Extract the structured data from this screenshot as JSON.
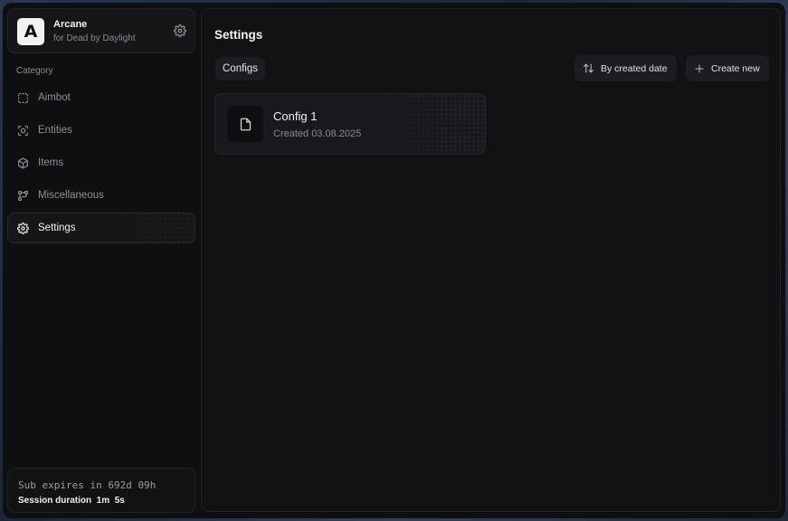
{
  "brand": {
    "logo_letter": "A",
    "name": "Arcane",
    "subtitle": "for Dead by Daylight"
  },
  "sidebar": {
    "category_label": "Category",
    "items": [
      {
        "label": "Aimbot",
        "icon": "dashed-square-icon"
      },
      {
        "label": "Entities",
        "icon": "scan-face-icon"
      },
      {
        "label": "Items",
        "icon": "cube-icon"
      },
      {
        "label": "Miscellaneous",
        "icon": "nodes-icon"
      },
      {
        "label": "Settings",
        "icon": "gear-icon",
        "active": true
      }
    ]
  },
  "session": {
    "sub_expires": "Sub expires in 692d 09h",
    "duration": "Session duration  1m  5s"
  },
  "main": {
    "title": "Settings",
    "tab_configs": "Configs",
    "sort_label": "By created date",
    "create_label": "Create new",
    "configs": [
      {
        "name": "Config 1",
        "created": "Created 03.08.2025"
      }
    ]
  },
  "colors": {
    "background": "#0e0f11",
    "panel": "#111214",
    "card": "#18191c",
    "text": "#f2f2f3",
    "muted": "#8a8b90"
  }
}
